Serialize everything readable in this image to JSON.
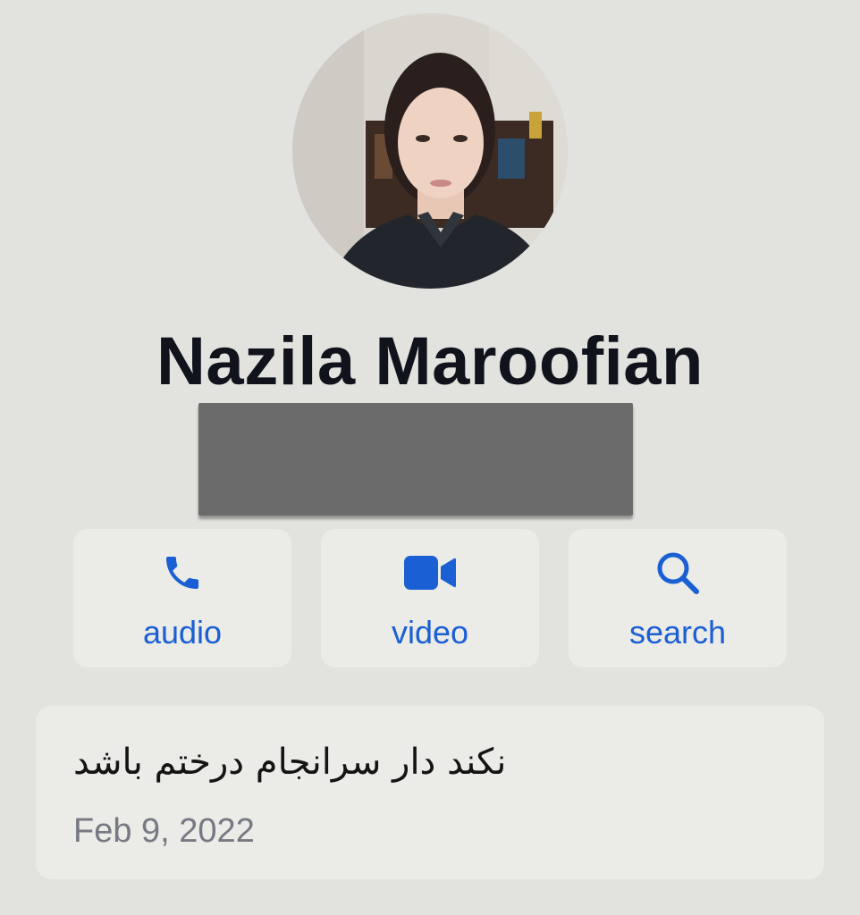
{
  "profile": {
    "name": "Nazila Maroofian"
  },
  "actions": [
    {
      "label": "audio",
      "icon": "phone-icon"
    },
    {
      "label": "video",
      "icon": "video-camera-icon"
    },
    {
      "label": "search",
      "icon": "search-icon"
    }
  ],
  "status": {
    "text": "نکند دار سرانجام درختم باشد",
    "date": "Feb 9, 2022"
  },
  "colors": {
    "background": "#e2e2de",
    "card": "#ebebe7",
    "accent": "#1a5fd4",
    "name_text": "#10131c",
    "secondary_text": "#767982",
    "redaction": "#6b6b6b"
  }
}
